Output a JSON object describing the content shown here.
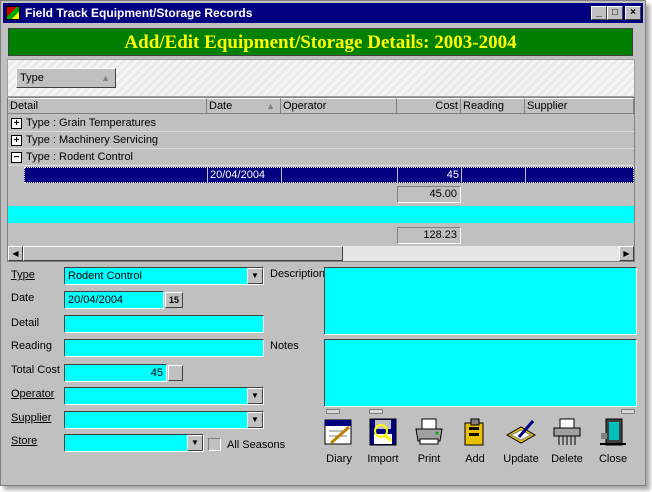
{
  "window": {
    "title": "Field Track Equipment/Storage Records",
    "controls": {
      "minimize": "_",
      "maximize": "□",
      "close": "×"
    }
  },
  "header": {
    "heading": "Add/Edit Equipment/Storage Details: 2003-2004"
  },
  "group_panel": {
    "chip_label": "Type"
  },
  "grid": {
    "columns": [
      "Detail",
      "Date",
      "Operator",
      "Cost",
      "Reading",
      "Supplier"
    ],
    "groups": [
      {
        "label": "Type : Grain Temperatures",
        "expander": "+"
      },
      {
        "label": "Type : Machinery Servicing",
        "expander": "+"
      },
      {
        "label": "Type : Rodent Control",
        "expander": "−"
      }
    ],
    "selected_row": {
      "detail": "",
      "date": "20/04/2004",
      "operator": "",
      "cost": "45",
      "reading": "",
      "supplier": ""
    },
    "group_total": "45.00",
    "grand_total": "128.23"
  },
  "form": {
    "type_label": "Type",
    "type_value": "Rodent Control",
    "date_label": "Date",
    "date_value": "20/04/2004",
    "date_button": "15",
    "detail_label": "Detail",
    "reading_label": "Reading",
    "total_cost_label": "Total Cost",
    "total_cost_value": "45",
    "operator_label": "Operator",
    "supplier_label": "Supplier",
    "store_label": "Store",
    "all_seasons_label": "All Seasons",
    "description_label": "Description",
    "notes_label": "Notes"
  },
  "toolbar": {
    "diary": "Diary",
    "import": "Import",
    "print": "Print",
    "add": "Add",
    "update": "Update",
    "delete": "Delete",
    "close": "Close"
  },
  "colors": {
    "title_bar": "#000080",
    "header_bg": "#008000",
    "header_text": "#ffff00",
    "field_bg": "#00ffff",
    "selection": "#000080"
  }
}
